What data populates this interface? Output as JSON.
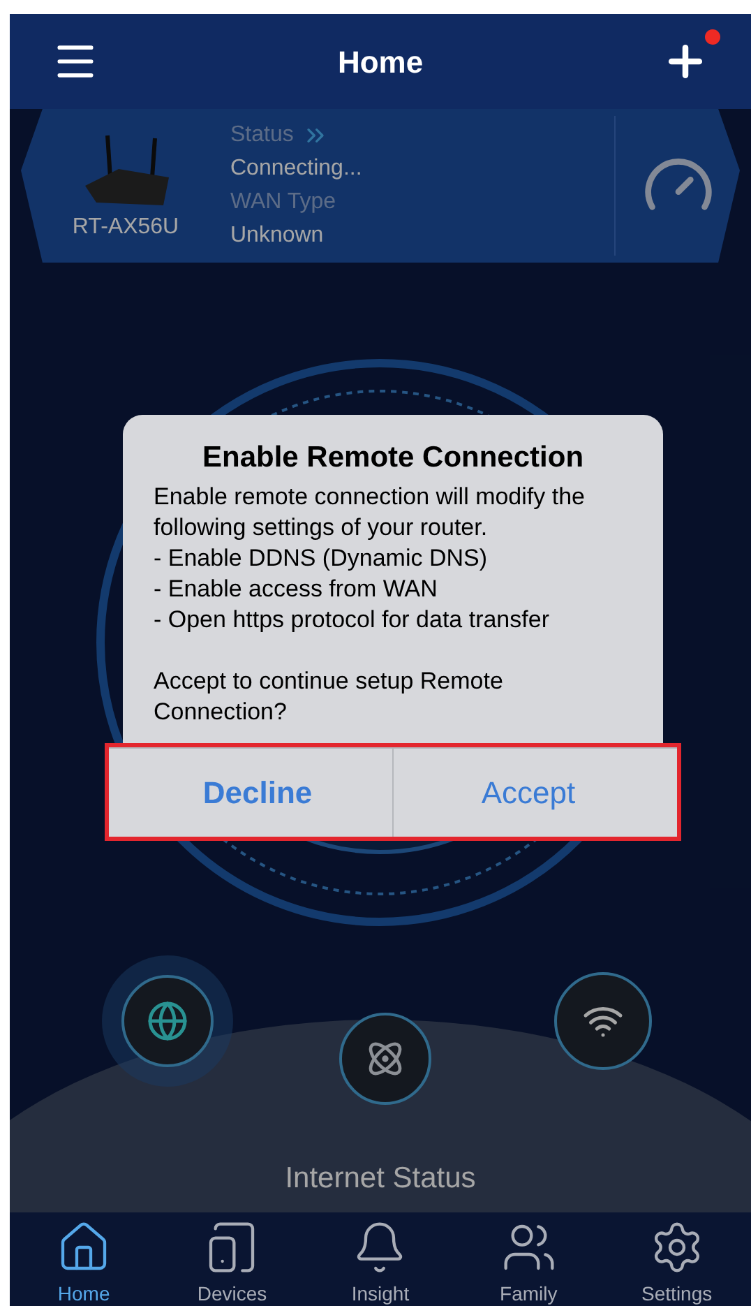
{
  "header": {
    "title": "Home",
    "notification_dot": true
  },
  "router_card": {
    "model": "RT-AX56U",
    "status_label": "Status",
    "status_value": "Connecting...",
    "wan_label": "WAN Type",
    "wan_value": "Unknown"
  },
  "dialog": {
    "title": "Enable Remote Connection",
    "message": "Enable remote connection will modify the following settings of your router.",
    "bullets": [
      "- Enable DDNS (Dynamic DNS)",
      "- Enable access from WAN",
      "- Open https protocol for data transfer"
    ],
    "question": "Accept to continue setup Remote Connection?",
    "buttons": [
      "Decline",
      "Accept"
    ],
    "highlighted": true
  },
  "internet_status": "Internet Status",
  "tabs": [
    {
      "label": "Home",
      "selected": true
    },
    {
      "label": "Devices",
      "selected": false
    },
    {
      "label": "Insight",
      "selected": false
    },
    {
      "label": "Family",
      "selected": false
    },
    {
      "label": "Settings",
      "selected": false
    }
  ]
}
